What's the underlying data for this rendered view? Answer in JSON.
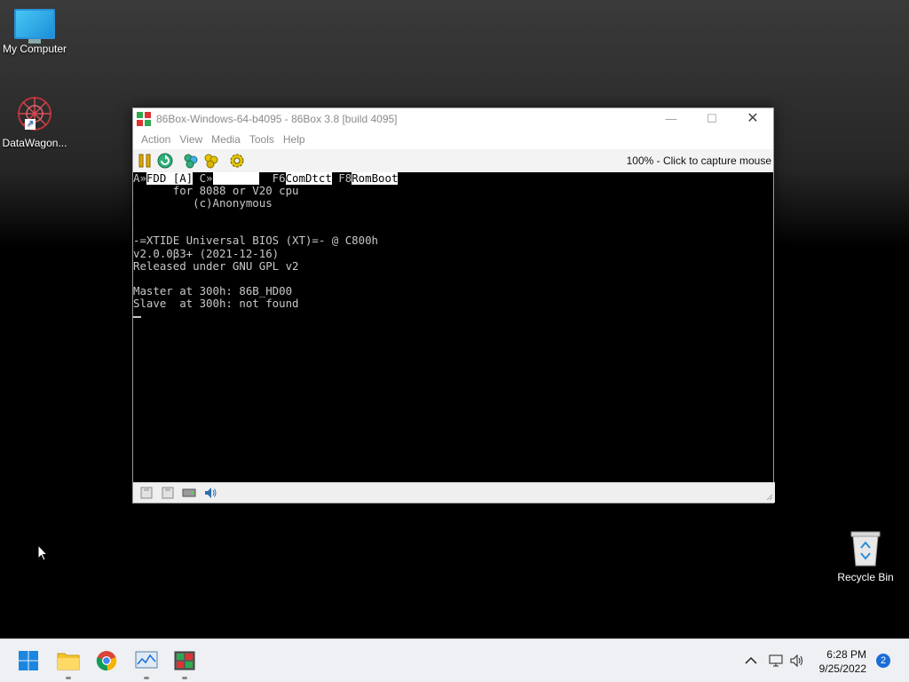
{
  "desktop": {
    "icons": [
      {
        "label": "My Computer"
      },
      {
        "label": "DataWagon..."
      },
      {
        "label": "Recycle Bin"
      }
    ]
  },
  "window": {
    "title": "86Box-Windows-64-b4095 - 86Box 3.8 [build 4095]",
    "menu": [
      "Action",
      "View",
      "Media",
      "Tools",
      "Help"
    ],
    "toolbar": {
      "buttons": [
        "pause-icon",
        "reset-icon",
        "ctrl-alt-del-icon",
        "ctrl-alt-esc-icon",
        "settings-icon"
      ],
      "capture_text": "100% - Click to capture mouse"
    },
    "screen": {
      "header": {
        "a_prefix": "A»",
        "fdd_label": "FDD [A]",
        "c_prefix": " C»",
        "c_field": "       ",
        "f6_key": "  F6",
        "f6_label": "ComDtct",
        "f8_key": " F8",
        "f8_label": "RomBoot"
      },
      "lines": [
        "      for 8088 or V20 cpu",
        "         (c)Anonymous",
        "",
        "",
        "-=XTIDE Universal BIOS (XT)=- @ C800h",
        "v2.0.0β3+ (2021-12-16)",
        "Released under GNU GPL v2",
        "",
        "Master at 300h: 86B_HD00",
        "Slave  at 300h: not found"
      ]
    },
    "statusbar": [
      "floppy-a-icon",
      "floppy-b-icon",
      "hdd-icon",
      "sound-icon"
    ]
  },
  "taskbar": {
    "apps": [
      "start-icon",
      "file-explorer-icon",
      "chrome-icon",
      "task-manager-icon",
      "86box-icon"
    ],
    "tray": {
      "time": "6:28 PM",
      "date": "9/25/2022",
      "notification_count": "2"
    }
  }
}
